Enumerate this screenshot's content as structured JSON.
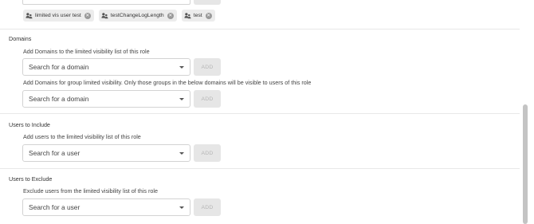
{
  "tags": [
    {
      "label": "limited vis user test"
    },
    {
      "label": "testChangeLogLength"
    },
    {
      "label": "test"
    }
  ],
  "domains": {
    "title": "Domains",
    "desc_primary": "Add Domains to the limited visibility list of this role",
    "select_primary": "Search for a domain",
    "desc_group": "Add Domains for group limited visibility. Only those groups in the below domains will be visible to users of this role",
    "select_group": "Search for a domain",
    "add_label": "ADD"
  },
  "include": {
    "title": "Users to Include",
    "desc": "Add users to the limited visibility list of this role",
    "select": "Search for a user",
    "add_label": "ADD"
  },
  "exclude": {
    "title": "Users to Exclude",
    "desc": "Exclude users from the limited visibility list of this role",
    "select": "Search for a user",
    "add_label": "ADD"
  }
}
